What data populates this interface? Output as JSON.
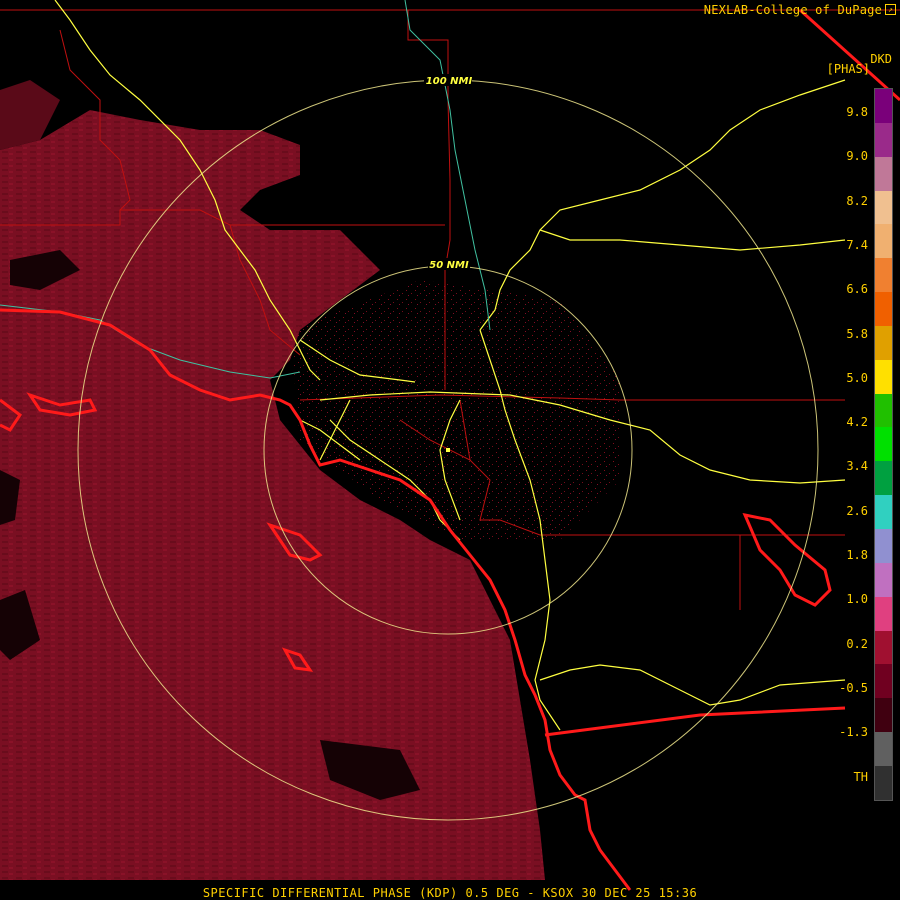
{
  "header": {
    "credit": "NEXLAB-College of DuPage",
    "product_code": "DKD",
    "units": "[PHAS]"
  },
  "colorbar": {
    "tick_labels": [
      "9.8",
      "9.0",
      "8.2",
      "7.4",
      "6.6",
      "5.8",
      "5.0",
      "4.2",
      "3.4",
      "2.6",
      "1.8",
      "1.0",
      "0.2",
      "-0.5",
      "-1.3",
      "TH"
    ],
    "colors": [
      "#7a007a",
      "#9a2a8a",
      "#c07898",
      "#f0c090",
      "#f0b070",
      "#f08030",
      "#f06000",
      "#e0a000",
      "#ffe000",
      "#20c000",
      "#00e000",
      "#00a040",
      "#30d0c0",
      "#9090d0",
      "#c070c0",
      "#e04080",
      "#a01030",
      "#700020",
      "#400010",
      "#606060",
      "#303030"
    ]
  },
  "range_rings": [
    "50 NMI",
    "100 NMI"
  ],
  "map_colors": {
    "echo": "#7a0f22",
    "coast": "#ff1a1a",
    "highways": "#ffff40",
    "boundaries": "#c01010",
    "rings": "#f0e68c"
  },
  "footer": {
    "caption": "SPECIFIC DIFFERENTIAL PHASE (KDP) 0.5 DEG - KSOX 30 DEC 25 15:36"
  }
}
